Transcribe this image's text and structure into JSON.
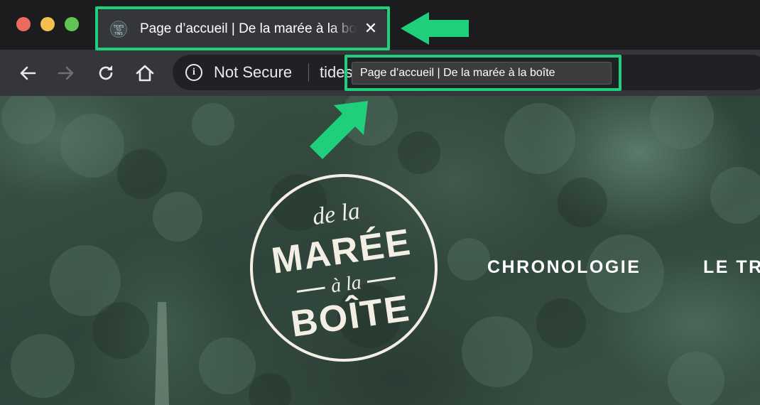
{
  "browser": {
    "tab": {
      "favicon_text": [
        "TIDES",
        "TO",
        "TINS"
      ],
      "title": "Page d’accueil | De la marée à la boîte",
      "close_label": "✕"
    },
    "toolbar": {
      "back_icon": "arrow-left",
      "forward_icon": "arrow-right",
      "reload_icon": "reload",
      "home_icon": "home"
    },
    "omnibox": {
      "security_label": "Not Secure",
      "url_partial": "tides",
      "info_icon_glyph": "i"
    },
    "tooltip": {
      "text": "Page d’accueil | De la marée à la boîte"
    },
    "highlight_color": "#1fcf7c"
  },
  "page": {
    "logo": {
      "line1": "de la",
      "line2": "MARÉE",
      "line3": "à la",
      "line4": "BOÎTE"
    },
    "nav": [
      {
        "label": "CHRONOLOGIE"
      },
      {
        "label": "LE TR"
      }
    ]
  }
}
